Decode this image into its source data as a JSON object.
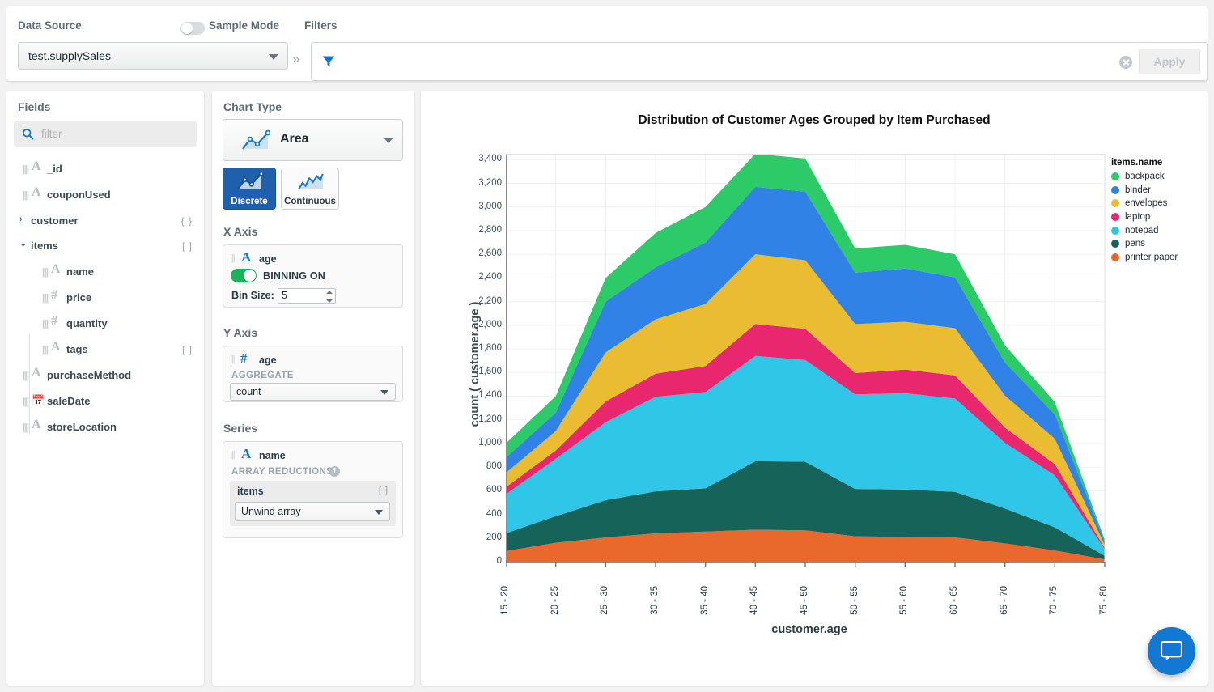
{
  "topbar": {
    "data_source_label": "Data Source",
    "data_source_value": "test.supplySales",
    "sample_mode_label": "Sample Mode",
    "sample_mode_on": false,
    "filters_label": "Filters",
    "filters_value": "",
    "apply_label": "Apply",
    "chevron": "»"
  },
  "fields": {
    "title": "Fields",
    "filter_placeholder": "filter",
    "items": [
      {
        "label": "_id",
        "type": "A",
        "indent": 0,
        "brace": "",
        "expander": ""
      },
      {
        "label": "couponUsed",
        "type": "A",
        "indent": 0,
        "brace": "",
        "expander": ""
      },
      {
        "label": "customer",
        "type": "",
        "indent": 0,
        "brace": "{ }",
        "expander": "collapsed"
      },
      {
        "label": "items",
        "type": "",
        "indent": 0,
        "brace": "[ ]",
        "expander": "expanded"
      },
      {
        "label": "name",
        "type": "A",
        "indent": 1,
        "brace": "",
        "expander": ""
      },
      {
        "label": "price",
        "type": "#",
        "indent": 1,
        "brace": "",
        "expander": ""
      },
      {
        "label": "quantity",
        "type": "#",
        "indent": 1,
        "brace": "",
        "expander": ""
      },
      {
        "label": "tags",
        "type": "A",
        "indent": 1,
        "brace": "[ ]",
        "expander": ""
      },
      {
        "label": "purchaseMethod",
        "type": "A",
        "indent": 0,
        "brace": "",
        "expander": ""
      },
      {
        "label": "saleDate",
        "type": "cal",
        "indent": 0,
        "brace": "",
        "expander": ""
      },
      {
        "label": "storeLocation",
        "type": "A",
        "indent": 0,
        "brace": "",
        "expander": ""
      }
    ]
  },
  "config": {
    "chart_type_label": "Chart Type",
    "chart_type_value": "Area",
    "mode_discrete": "Discrete",
    "mode_continuous": "Continuous",
    "mode_selected": "Discrete",
    "x_axis_label": "X Axis",
    "x_field": "age",
    "x_field_type": "A",
    "binning_label": "BINNING ON",
    "binning_on": true,
    "bin_size_label": "Bin Size:",
    "bin_size_value": "5",
    "y_axis_label": "Y Axis",
    "y_field": "age",
    "y_field_type": "#",
    "aggregate_label": "AGGREGATE",
    "aggregate_value": "count",
    "series_label": "Series",
    "series_field": "name",
    "series_field_type": "A",
    "array_reductions_label": "ARRAY REDUCTIONS",
    "array_reduction_field": "items",
    "array_reduction_brace": "[ ]",
    "array_reduction_value": "Unwind array"
  },
  "chart_data": {
    "type": "area",
    "stacked": true,
    "title": "Distribution of Customer Ages Grouped by Item Purchased",
    "xlabel": "customer.age",
    "ylabel": "count ( customer.age )",
    "legend_title": "items.name",
    "legend_position": "right",
    "grid": true,
    "ylim": [
      0,
      3450
    ],
    "yticks": [
      0,
      200,
      400,
      600,
      800,
      1000,
      1200,
      1400,
      1600,
      1800,
      2000,
      2200,
      2400,
      2600,
      2800,
      3000,
      3200,
      3400
    ],
    "ytick_labels": [
      "0",
      "200",
      "400",
      "600",
      "800",
      "1,000",
      "1,200",
      "1,400",
      "1,600",
      "1,800",
      "2,000",
      "2,200",
      "2,400",
      "2,600",
      "2,800",
      "3,000",
      "3,200",
      "3,400"
    ],
    "categories": [
      "15 - 20",
      "20 - 25",
      "25 - 30",
      "30 - 35",
      "35 - 40",
      "40 - 45",
      "45 - 50",
      "50 - 55",
      "55 - 60",
      "60 - 65",
      "65 - 70",
      "70 - 75",
      "75 - 80"
    ],
    "stack_order": [
      "printer paper",
      "pens",
      "notepad",
      "laptop",
      "envelopes",
      "binder",
      "backpack"
    ],
    "series": [
      {
        "name": "printer paper",
        "color": "#e8692b",
        "values": [
          90,
          160,
          205,
          240,
          255,
          270,
          265,
          215,
          210,
          205,
          155,
          95,
          20
        ]
      },
      {
        "name": "pens",
        "color": "#16635a",
        "values": [
          150,
          225,
          315,
          355,
          365,
          580,
          580,
          400,
          400,
          385,
          295,
          195,
          30
        ]
      },
      {
        "name": "notepad",
        "color": "#2fc6e8",
        "values": [
          330,
          485,
          660,
          800,
          815,
          890,
          860,
          800,
          815,
          790,
          555,
          440,
          55
        ]
      },
      {
        "name": "laptop",
        "color": "#e8276f",
        "values": [
          60,
          70,
          175,
          195,
          220,
          270,
          265,
          180,
          200,
          195,
          130,
          95,
          10
        ]
      },
      {
        "name": "envelopes",
        "color": "#eabc32",
        "values": [
          120,
          165,
          415,
          460,
          525,
          590,
          580,
          415,
          405,
          400,
          270,
          215,
          25
        ]
      },
      {
        "name": "binder",
        "color": "#3082e6",
        "values": [
          130,
          155,
          430,
          440,
          520,
          570,
          580,
          435,
          450,
          430,
          280,
          205,
          30
        ]
      },
      {
        "name": "backpack",
        "color": "#2dca68",
        "values": [
          120,
          140,
          200,
          290,
          300,
          280,
          280,
          205,
          200,
          195,
          145,
          105,
          15
        ]
      }
    ],
    "totals": [
      1000,
      1400,
      2400,
      2780,
      3000,
      3450,
      3410,
      2650,
      2680,
      2600,
      1830,
      1350,
      185
    ]
  },
  "chat": {
    "label": "chat-widget"
  }
}
